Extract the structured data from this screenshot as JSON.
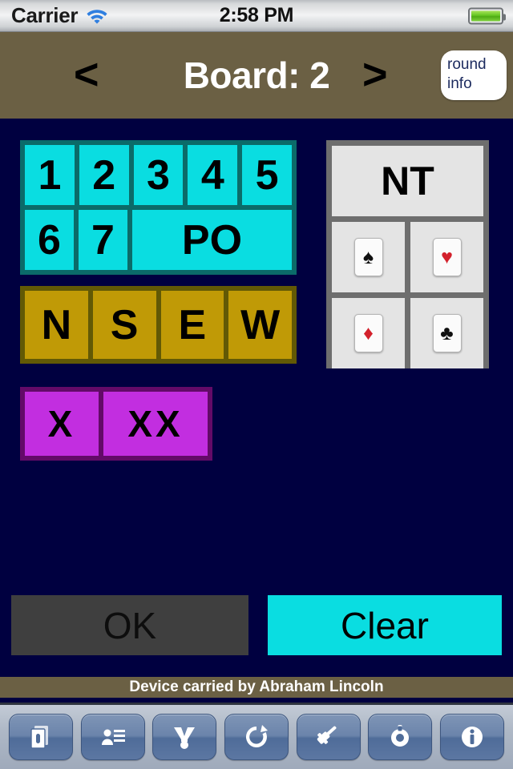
{
  "status_bar": {
    "carrier": "Carrier",
    "wifi_icon": "wifi-icon",
    "time": "2:58 PM",
    "battery_icon": "battery-full-icon"
  },
  "nav_bar": {
    "prev_label": "<",
    "title": "Board: 2",
    "next_label": ">",
    "round_info_label": "round info",
    "background_color": "#6b6044",
    "title_color": "#ffffff"
  },
  "bidding": {
    "levels_row1": [
      "1",
      "2",
      "3",
      "4",
      "5"
    ],
    "levels_row2": [
      "6",
      "7"
    ],
    "pass_out_label": "PO",
    "level_color": "#0adde1",
    "level_container_color": "#0b6b69",
    "directions": [
      "N",
      "S",
      "E",
      "W"
    ],
    "direction_color": "#c09a06",
    "direction_container_color": "#625905",
    "double_label": "X",
    "redouble_label": "XX",
    "double_color": "#c22ee0",
    "double_container_color": "#630a68",
    "notrump_label": "NT",
    "suits": [
      {
        "name": "spade",
        "glyph": "♠",
        "color": "black"
      },
      {
        "name": "heart",
        "glyph": "♥",
        "color": "red"
      },
      {
        "name": "diamond",
        "glyph": "♦",
        "color": "red"
      },
      {
        "name": "club",
        "glyph": "♣",
        "color": "black"
      }
    ],
    "suit_container_color": "#6e6e6e",
    "suit_button_color": "#e4e4e4"
  },
  "actions": {
    "ok_label": "OK",
    "ok_color": "#3f3f3f",
    "clear_label": "Clear",
    "clear_color": "#0adde1"
  },
  "footer": {
    "text": "Device carried by Abraham Lincoln",
    "background_color": "#6b6044"
  },
  "toolbar": {
    "items": [
      {
        "icon": "boards-icon"
      },
      {
        "icon": "player-list-icon"
      },
      {
        "icon": "movement-icon"
      },
      {
        "icon": "sync-icon"
      },
      {
        "icon": "gavel-icon"
      },
      {
        "icon": "settings-icon"
      },
      {
        "icon": "info-icon"
      }
    ]
  },
  "background_color": "#000040"
}
